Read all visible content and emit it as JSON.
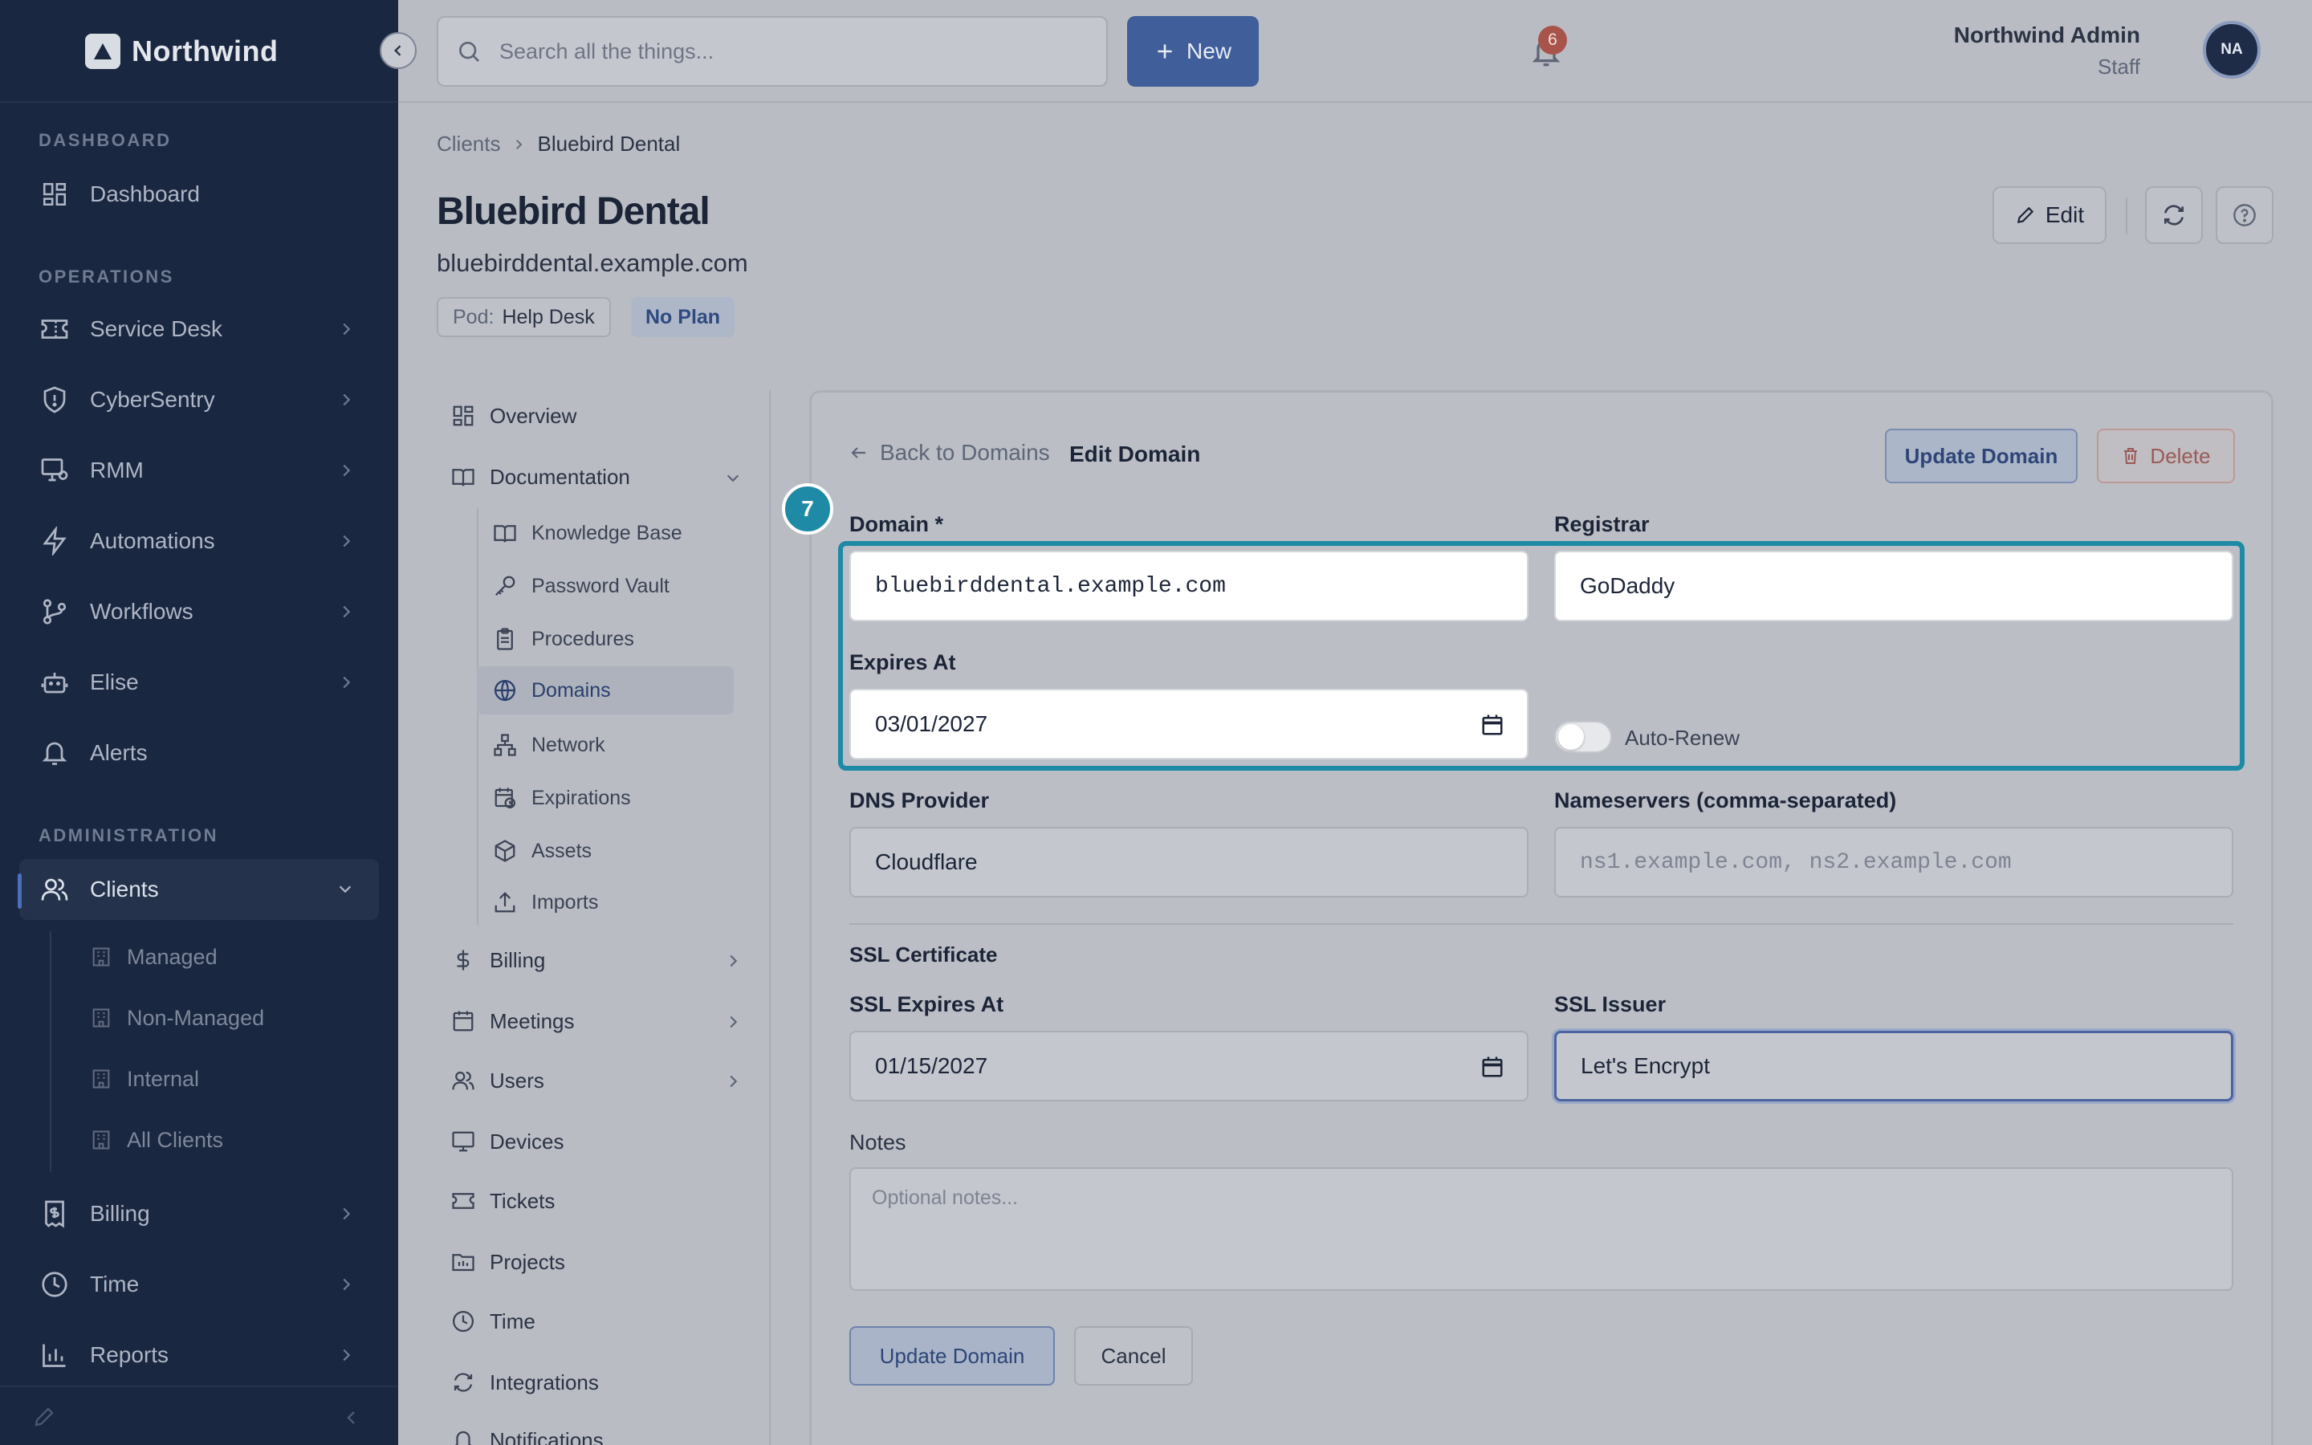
{
  "app": {
    "name": "Northwind"
  },
  "sidebar": {
    "sections": {
      "dashboard": "DASHBOARD",
      "operations": "OPERATIONS",
      "administration": "ADMINISTRATION"
    },
    "items": {
      "dashboard": "Dashboard",
      "service_desk": "Service Desk",
      "cybersentry": "CyberSentry",
      "rmm": "RMM",
      "automations": "Automations",
      "workflows": "Workflows",
      "elise": "Elise",
      "alerts": "Alerts",
      "clients": "Clients",
      "billing": "Billing",
      "time": "Time",
      "reports": "Reports"
    },
    "client_subitems": [
      "Managed",
      "Non-Managed",
      "Internal",
      "All Clients"
    ]
  },
  "topbar": {
    "search_placeholder": "Search all the things...",
    "new_label": "New",
    "notification_count": "6",
    "user_name": "Northwind Admin",
    "user_role": "Staff",
    "user_initials": "NA"
  },
  "breadcrumb": {
    "parent": "Clients",
    "current": "Bluebird Dental"
  },
  "client": {
    "name": "Bluebird Dental",
    "website": "bluebirddental.example.com",
    "pod_label": "Pod:",
    "pod_value": "Help Desk",
    "plan": "No Plan",
    "edit_label": "Edit"
  },
  "subnav": {
    "overview": "Overview",
    "documentation": "Documentation",
    "documentation_items": [
      "Knowledge Base",
      "Password Vault",
      "Procedures",
      "Domains",
      "Network",
      "Expirations",
      "Assets",
      "Imports"
    ],
    "billing": "Billing",
    "meetings": "Meetings",
    "users": "Users",
    "devices": "Devices",
    "tickets": "Tickets",
    "projects": "Projects",
    "time": "Time",
    "integrations": "Integrations",
    "notifications": "Notifications"
  },
  "form": {
    "back_label": "Back to Domains",
    "title": "Edit Domain",
    "update_top": "Update Domain",
    "delete": "Delete",
    "domain_label": "Domain *",
    "domain_value": "bluebirddental.example.com",
    "registrar_label": "Registrar",
    "registrar_value": "GoDaddy",
    "expires_label": "Expires At",
    "expires_value": "03/01/2027",
    "auto_renew_label": "Auto-Renew",
    "dns_label": "DNS Provider",
    "dns_value": "Cloudflare",
    "nameservers_label": "Nameservers (comma-separated)",
    "nameservers_placeholder": "ns1.example.com, ns2.example.com",
    "ssl_section": "SSL Certificate",
    "ssl_expires_label": "SSL Expires At",
    "ssl_expires_value": "01/15/2027",
    "ssl_issuer_label": "SSL Issuer",
    "ssl_issuer_value": "Let's Encrypt",
    "notes_label": "Notes",
    "notes_placeholder": "Optional notes...",
    "update_bottom": "Update Domain",
    "cancel": "Cancel"
  },
  "highlight": {
    "step": "7",
    "color": "#1f8aa6"
  }
}
